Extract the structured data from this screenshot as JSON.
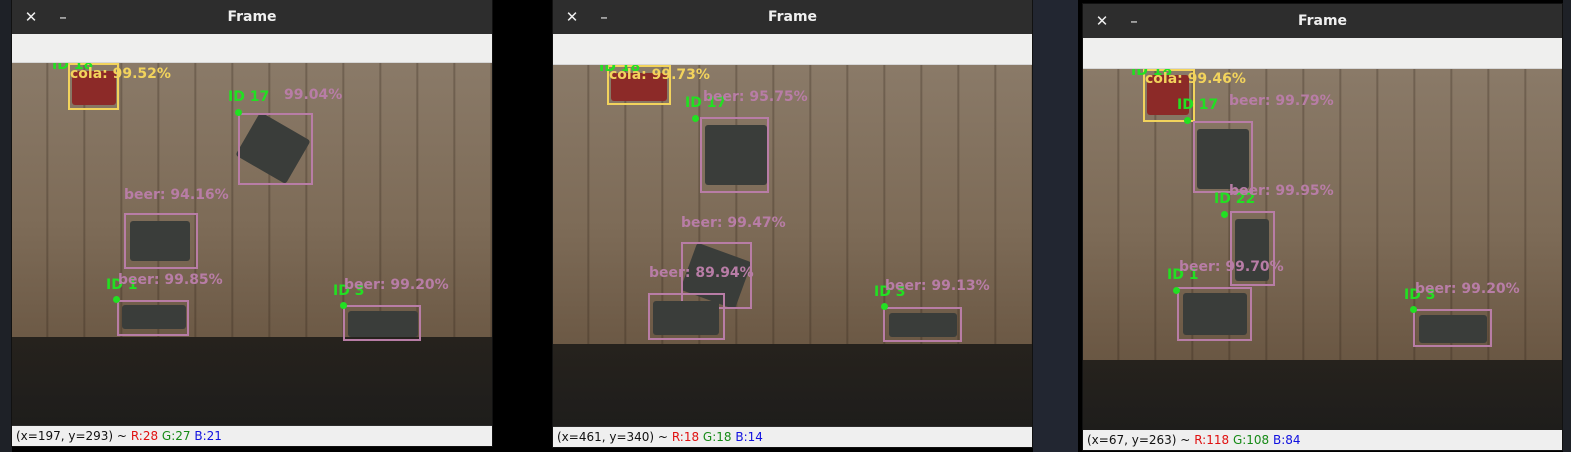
{
  "colors": {
    "beer_box": "#b87da6",
    "cola_box": "#f2d35c",
    "id_label": "#22e022",
    "status_r": "#e01010",
    "status_g": "#168a16",
    "status_b": "#1010e0"
  },
  "icons": {
    "close": "close-icon",
    "minimize": "minimize-icon"
  },
  "windows": [
    {
      "title": "Frame",
      "status": {
        "coords": "(x=197, y=293) ~",
        "r": "R:28",
        "g": "G:27",
        "b": "B:21"
      },
      "labels": {
        "cola": "cola: 99.52%",
        "cola_id": "ID 18",
        "id17": "ID 17",
        "beer17": "99.04%",
        "beer_mid": "beer: 94.16%",
        "beer1": "beer: 99.85%",
        "id1": "ID 1",
        "id3": "ID 3",
        "beer3": "beer: 99.20%"
      }
    },
    {
      "title": "Frame",
      "status": {
        "coords": "(x=461, y=340) ~",
        "r": "R:18",
        "g": "G:18",
        "b": "B:14"
      },
      "labels": {
        "cola": "cola: 99.73%",
        "cola_id": "ID 18",
        "id17": "ID 17",
        "beer17": "beer: 95.75%",
        "beer_mid": "beer: 99.47%",
        "beer_low": "beer: 89.94%",
        "id3": "ID 3",
        "beer3": "beer: 99.13%"
      }
    },
    {
      "title": "Frame",
      "status": {
        "coords": "(x=67, y=263) ~",
        "r": "R:118",
        "g": "G:108",
        "b": "B:84"
      },
      "labels": {
        "cola": "cola: 99.46%",
        "cola_id": "ID 18",
        "id17": "ID 17",
        "beer17": "beer: 99.79%",
        "beer22": "beer: 99.95%",
        "id22": "ID 22",
        "beer1": "beer: 99.70%",
        "id1": "ID 1",
        "id3": "ID 3",
        "beer3": "beer: 99.20%"
      }
    }
  ]
}
